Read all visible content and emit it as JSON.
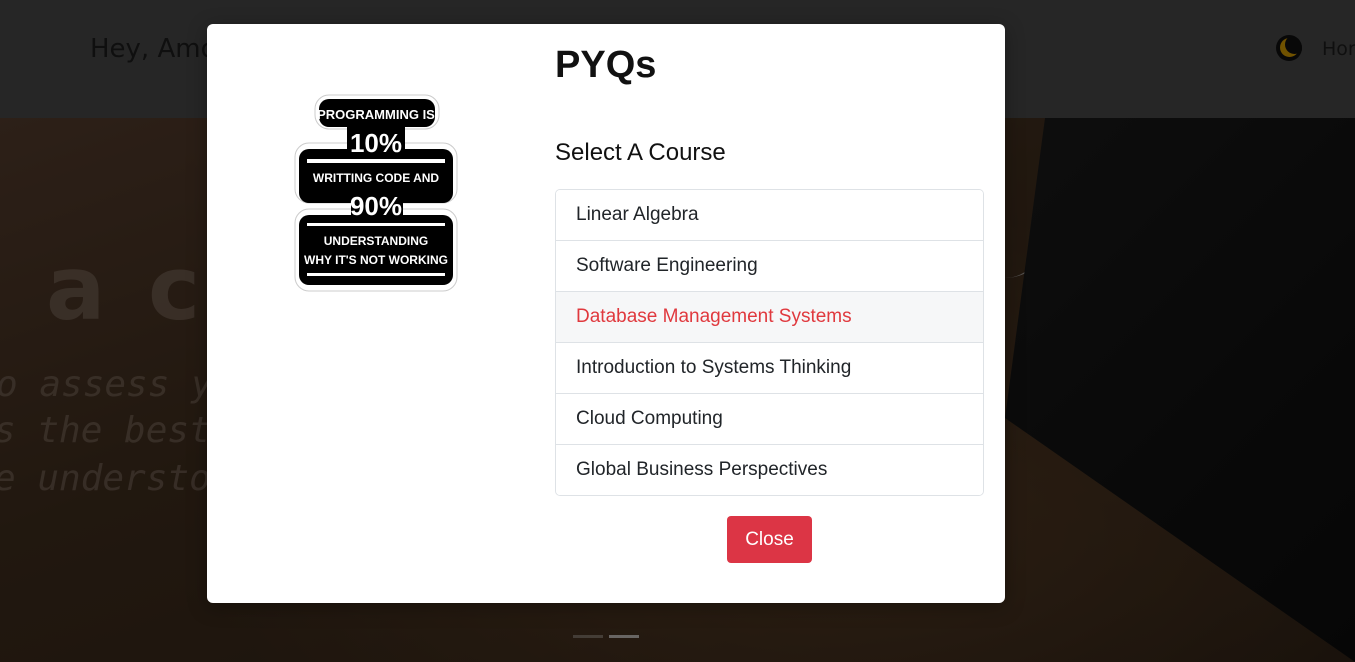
{
  "navbar": {
    "greeting": "Hey, Amo",
    "home_link": "Hor",
    "theme_icon": "moon-icon"
  },
  "hero": {
    "big_text": "a c",
    "lines": [
      "o  assess  yo",
      "s  the  best  w",
      "e  understood  any  topic  e."
    ]
  },
  "modal": {
    "title": "PYQs",
    "sticker": {
      "line1": "PROGRAMMING IS",
      "line2": "10%",
      "line3": "WRITTING CODE AND",
      "line4": "90%",
      "line5": "UNDERSTANDING",
      "line6": "WHY IT'S NOT WORKING"
    },
    "section_label": "Select A Course",
    "courses": [
      {
        "label": "Linear Algebra"
      },
      {
        "label": "Software Engineering"
      },
      {
        "label": "Database Management Systems"
      },
      {
        "label": "Introduction to Systems Thinking"
      },
      {
        "label": "Cloud Computing"
      },
      {
        "label": "Global Business Perspectives"
      }
    ],
    "close_label": "Close"
  },
  "colors": {
    "danger": "#dc3545",
    "hover_text": "#e0393e",
    "list_border": "#dee2e6"
  }
}
